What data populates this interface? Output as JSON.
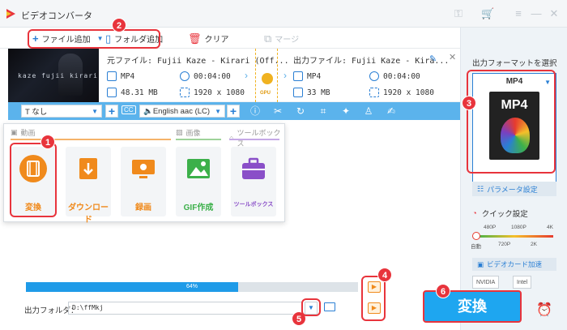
{
  "app": {
    "title": "ビデオコンバータ",
    "icons": [
      "key-icon",
      "cart-icon",
      "menu-icon",
      "minimize-icon",
      "close-icon"
    ]
  },
  "toolbar": {
    "add_file": "ファイル追加",
    "add_folder": "フォルダ追加",
    "clear": "クリア",
    "merge": "マージ"
  },
  "file": {
    "thumbnail_caption": "kaze fujii kirari",
    "source_name": "元ファイル: Fujii Kaze - Kirari (Off...",
    "source_format": "MP4",
    "source_duration": "00:04:00",
    "source_size": "48.31 MB",
    "source_resolution": "1920 x 1080",
    "gpu_label": "GPU",
    "output_name": "出力ファイル: Fujii Kaze - Kira...",
    "output_format": "MP4",
    "output_duration": "00:04:00",
    "output_size": "33 MB",
    "output_resolution": "1920 x 1080"
  },
  "edit_bar": {
    "subtitle_value": "なし",
    "cc_label": "CC",
    "audio_value": "English aac (LC)"
  },
  "popup": {
    "cat_video": "動画",
    "cat_image": "画像",
    "cat_toolbox": "ツールボックス",
    "buttons": [
      {
        "label": "変換",
        "color": "#f08a1c"
      },
      {
        "label": "ダウンロード",
        "color": "#f08a1c"
      },
      {
        "label": "録画",
        "color": "#f08a1c"
      },
      {
        "label": "GIF作成",
        "color": "#3cb04a"
      },
      {
        "label": "ツールボックス",
        "color": "#8a4fc8"
      }
    ]
  },
  "progress": {
    "value_percent": 64,
    "label": "64%"
  },
  "output_folder": {
    "label": "出力フォルダ：",
    "path": "D:\\ffMkj"
  },
  "sidebar": {
    "select_format": "出力フォーマットを選択",
    "format_name": "MP4",
    "format_badge": "MP4",
    "param_settings": "パラメータ設定",
    "quick_settings": "クイック設定",
    "q_480": "480P",
    "q_1080": "1080P",
    "q_4k": "4K",
    "q_auto": "自動",
    "q_720": "720P",
    "q_2k": "2K",
    "hw_accel": "ビデオカード加速",
    "nvidia": "NVIDIA",
    "intel": "Intel"
  },
  "convert_button": "変換",
  "callouts": [
    "1",
    "2",
    "3",
    "4",
    "5",
    "6"
  ],
  "colors": {
    "accent_blue": "#1ea6f0",
    "callout_red": "#e8343c",
    "orange": "#f08a1c"
  }
}
